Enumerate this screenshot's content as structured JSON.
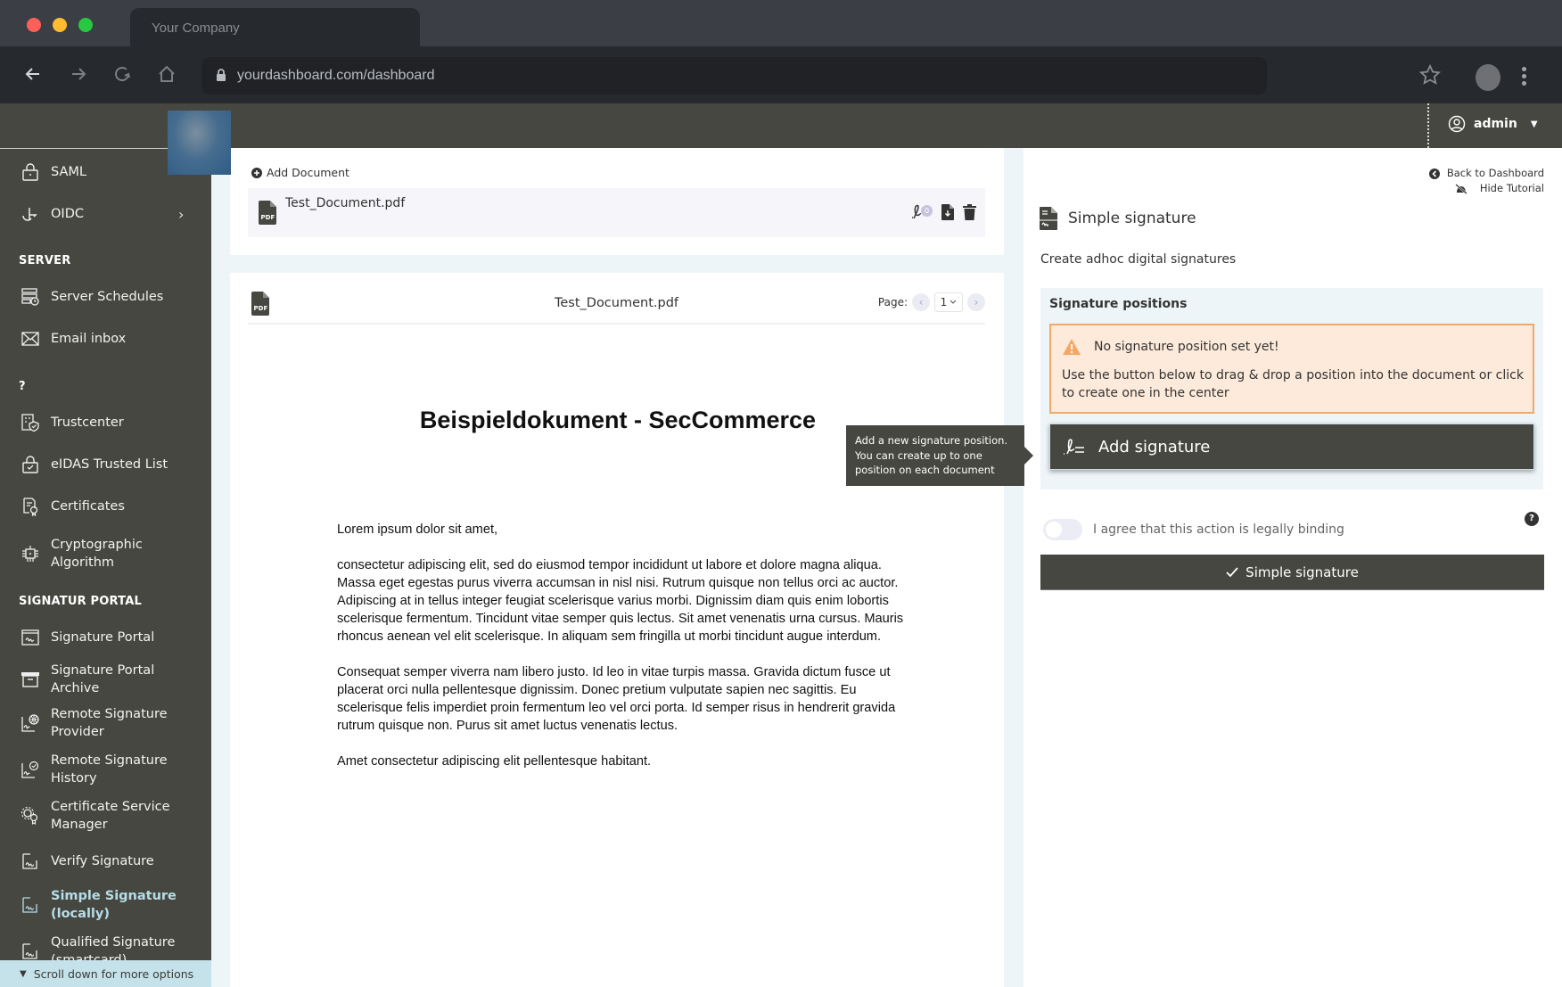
{
  "browser": {
    "tab_title": "Your Company",
    "url": "yourdashboard.com/dashboard"
  },
  "header": {
    "user_label": "admin"
  },
  "sidebar": {
    "items_top": [
      {
        "label": "SAML",
        "icon": "lock-icon"
      },
      {
        "label": "OIDC",
        "icon": "oidc-icon",
        "has_submenu": true
      }
    ],
    "sections": [
      {
        "title": "SERVER",
        "items": [
          {
            "label": "Server Schedules",
            "icon": "server-schedule-icon"
          },
          {
            "label": "Email inbox",
            "icon": "envelope-icon"
          }
        ]
      },
      {
        "title": "?",
        "items": [
          {
            "label": "Trustcenter",
            "icon": "trustcenter-icon"
          },
          {
            "label": "eIDAS Trusted List",
            "icon": "trusted-list-icon"
          },
          {
            "label": "Certificates",
            "icon": "certificate-icon"
          },
          {
            "label": "Cryptographic Algorithm",
            "icon": "chip-icon"
          }
        ]
      },
      {
        "title": "SIGNATUR PORTAL",
        "items": [
          {
            "label": "Signature Portal",
            "icon": "signature-portal-icon"
          },
          {
            "label": "Signature Portal Archive",
            "icon": "archive-icon"
          },
          {
            "label": "Remote Signature Provider",
            "icon": "remote-provider-icon"
          },
          {
            "label": "Remote Signature History",
            "icon": "remote-history-icon"
          },
          {
            "label": "Certificate Service Manager",
            "icon": "gears-icon"
          },
          {
            "label": "Verify Signature",
            "icon": "verify-signature-icon"
          },
          {
            "label": "Simple Signature (locally)",
            "icon": "simple-signature-icon",
            "active": true
          },
          {
            "label": "Qualified Signature (smartcard)",
            "icon": "qualified-signature-icon"
          }
        ]
      }
    ],
    "scroll_hint": "Scroll down for more options"
  },
  "documents": {
    "add_label": "Add Document",
    "list": [
      {
        "name": "Test_Document.pdf",
        "signature_count": "0"
      }
    ]
  },
  "viewer": {
    "file_name": "Test_Document.pdf",
    "page_label": "Page:",
    "current_page": "1",
    "document": {
      "title": "Beispieldokument - SecCommerce",
      "paragraphs": [
        "Lorem ipsum dolor sit amet,",
        "consectetur adipiscing elit, sed do eiusmod tempor incididunt ut labore et dolore magna aliqua. Massa eget egestas purus viverra accumsan in nisl nisi. Rutrum quisque non tellus orci ac auctor. Adipiscing at in tellus integer feugiat scelerisque varius morbi. Dignissim diam quis enim lobortis scelerisque fermentum. Tincidunt vitae semper quis lectus. Sit amet venenatis urna cursus. Mauris rhoncus aenean vel elit scelerisque. In aliquam sem fringilla ut morbi tincidunt augue interdum.",
        "Consequat semper viverra nam libero justo. Id leo in vitae turpis massa. Gravida dictum fusce ut placerat orci nulla pellentesque dignissim. Donec pretium vulputate sapien nec sagittis. Eu scelerisque felis imperdiet proin fermentum leo vel orci porta. Id semper risus in hendrerit gravida rutrum quisque non. Purus sit amet luctus venenatis lectus.",
        "Amet consectetur adipiscing elit pellentesque habitant."
      ]
    }
  },
  "tooltip": {
    "text": "Add a new signature position. You can create up to one position on each document"
  },
  "panel": {
    "back_link": "Back to Dashboard",
    "hide_tutorial": "Hide Tutorial",
    "title": "Simple signature",
    "subtitle": "Create adhoc digital signatures",
    "positions_title": "Signature positions",
    "warning_title": "No signature position set yet!",
    "warning_text": "Use the button below to drag & drop a position into the document or click to create one in the center",
    "add_signature_label": "Add signature",
    "agree_label": "I agree that this action is legally binding",
    "agree_checked": false,
    "submit_label": "Simple signature"
  },
  "colors": {
    "sidebar_bg": "#474741",
    "active_item": "#b6dde8",
    "warning_border": "#f2a965",
    "warning_bg": "#fdeadb",
    "primary_button": "#474741",
    "gutter_bg": "#eef5f8"
  }
}
